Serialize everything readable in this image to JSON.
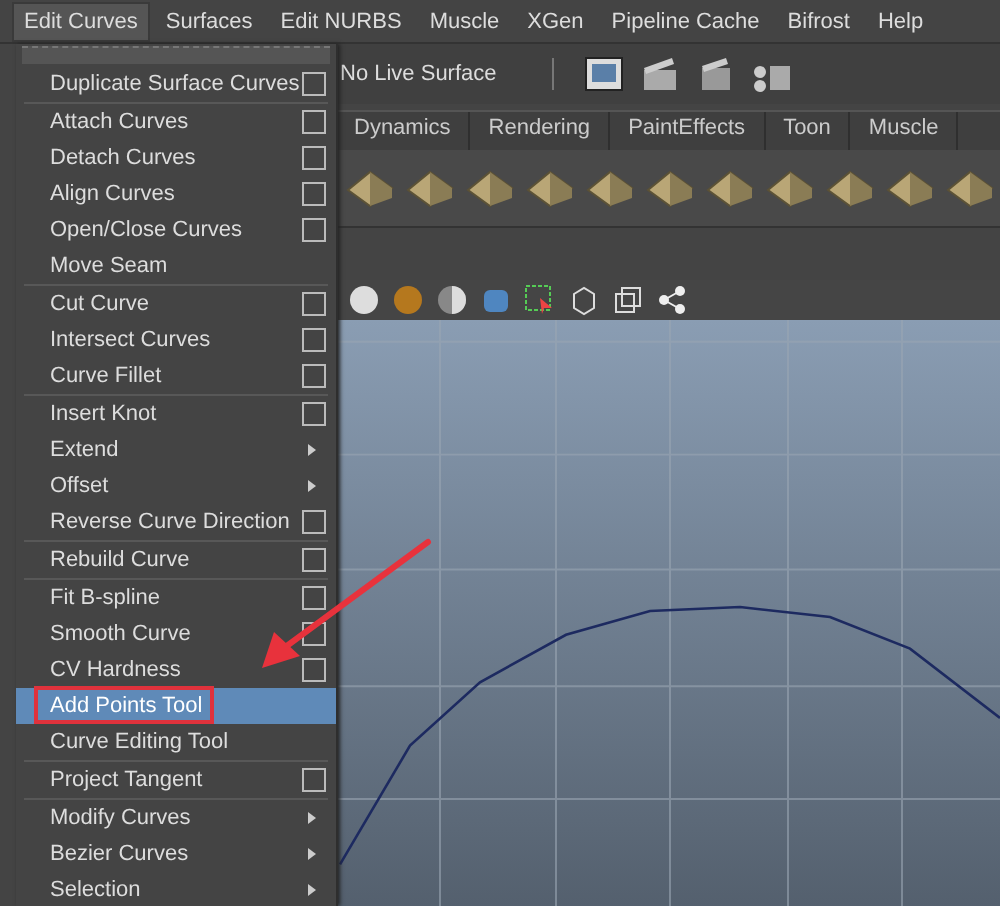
{
  "menu_bar": [
    {
      "label": "Edit Curves",
      "selected": true
    },
    {
      "label": "Surfaces",
      "selected": false
    },
    {
      "label": "Edit NURBS",
      "selected": false
    },
    {
      "label": "Muscle",
      "selected": false
    },
    {
      "label": "XGen",
      "selected": false
    },
    {
      "label": "Pipeline Cache",
      "selected": false
    },
    {
      "label": "Bifrost",
      "selected": false
    },
    {
      "label": "Help",
      "selected": false
    }
  ],
  "status_line": {
    "live_surface": "No Live Surface"
  },
  "shelf_tabs": [
    {
      "label": "Dynamics",
      "selected": false
    },
    {
      "label": "Rendering",
      "selected": false
    },
    {
      "label": "PaintEffects",
      "selected": false
    },
    {
      "label": "Toon",
      "selected": false
    },
    {
      "label": "Muscle",
      "selected": false
    }
  ],
  "menu": {
    "sections": [
      {
        "items": [
          {
            "label": "Duplicate Surface Curves",
            "kind": "option",
            "selected": false,
            "circled": false
          }
        ]
      },
      {
        "items": [
          {
            "label": "Attach Curves",
            "kind": "option",
            "selected": false,
            "circled": false
          },
          {
            "label": "Detach Curves",
            "kind": "option",
            "selected": false,
            "circled": false
          },
          {
            "label": "Align Curves",
            "kind": "option",
            "selected": false,
            "circled": false
          },
          {
            "label": "Open/Close Curves",
            "kind": "option",
            "selected": false,
            "circled": false
          },
          {
            "label": "Move Seam",
            "kind": "plain",
            "selected": false,
            "circled": false
          }
        ]
      },
      {
        "items": [
          {
            "label": "Cut Curve",
            "kind": "option",
            "selected": false,
            "circled": false
          },
          {
            "label": "Intersect Curves",
            "kind": "option",
            "selected": false,
            "circled": false
          },
          {
            "label": "Curve Fillet",
            "kind": "option",
            "selected": false,
            "circled": false
          }
        ]
      },
      {
        "items": [
          {
            "label": "Insert Knot",
            "kind": "option",
            "selected": false,
            "circled": false
          },
          {
            "label": "Extend",
            "kind": "submenu",
            "selected": false,
            "circled": false
          },
          {
            "label": "Offset",
            "kind": "submenu",
            "selected": false,
            "circled": false
          },
          {
            "label": "Reverse Curve Direction",
            "kind": "option",
            "selected": false,
            "circled": false
          }
        ]
      },
      {
        "items": [
          {
            "label": "Rebuild Curve",
            "kind": "option",
            "selected": false,
            "circled": false
          }
        ]
      },
      {
        "items": [
          {
            "label": "Fit B-spline",
            "kind": "option",
            "selected": false,
            "circled": false
          },
          {
            "label": "Smooth Curve",
            "kind": "option",
            "selected": false,
            "circled": false
          },
          {
            "label": "CV Hardness",
            "kind": "option",
            "selected": false,
            "circled": false
          },
          {
            "label": "Add Points Tool",
            "kind": "plain",
            "selected": true,
            "circled": true
          },
          {
            "label": "Curve Editing Tool",
            "kind": "plain",
            "selected": false,
            "circled": false
          }
        ]
      },
      {
        "items": [
          {
            "label": "Project Tangent",
            "kind": "option",
            "selected": false,
            "circled": false
          }
        ]
      },
      {
        "items": [
          {
            "label": "Modify Curves",
            "kind": "submenu",
            "selected": false,
            "circled": false
          },
          {
            "label": "Bezier Curves",
            "kind": "submenu",
            "selected": false,
            "circled": false
          },
          {
            "label": "Selection",
            "kind": "submenu",
            "selected": false,
            "circled": false
          }
        ]
      }
    ]
  }
}
